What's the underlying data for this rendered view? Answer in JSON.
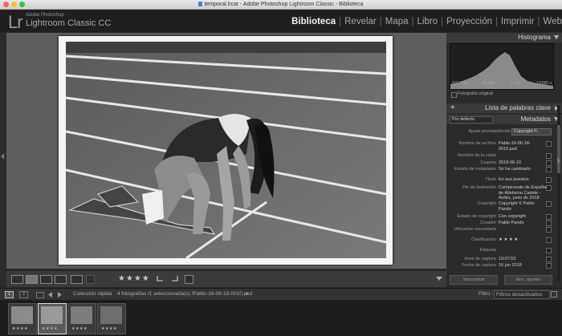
{
  "window": {
    "title": "temporal.lrcat - Adobe Photoshop Lightroom Classic - Biblioteca"
  },
  "app": {
    "logo": "Lr",
    "brand_small": "Adobe Photoshop",
    "brand_large": "Lightroom Classic CC"
  },
  "modules": [
    "Biblioteca",
    "Revelar",
    "Mapa",
    "Libro",
    "Proyección",
    "Imprimir",
    "Web"
  ],
  "active_module": "Biblioteca",
  "toolbar": {
    "rating": "★★★★"
  },
  "panels": {
    "histogram": {
      "title": "Histograma",
      "info": [
        "ISO 100",
        "50 mm",
        "f / 2,0",
        "1/1000 s"
      ],
      "original_label": "Fotografía original"
    },
    "keywords": {
      "title": "Lista de palabras clave",
      "plus": "+"
    },
    "metadata": {
      "preset": "Por defecto",
      "title": "Metadatos",
      "preset_row_label": "Ajuste preestablecido",
      "preset_row_value": "Copyright P...",
      "rows": [
        {
          "k": "Nombre de archivo",
          "v": "Pablo-16-06-18-0010.psd"
        },
        {
          "k": "Nombre de la copia",
          "v": ""
        },
        {
          "k": "Carpeta",
          "v": "2018-06-16"
        },
        {
          "k": "Estado de metadatos",
          "v": "Se ha cambiado"
        },
        {
          "k": "Título",
          "v": "En sus puestos"
        },
        {
          "k": "Pie de ilustración",
          "v": "Campeonato de España de Atletismo Cadete - Avilés, junio de 2018"
        },
        {
          "k": "Copyright",
          "v": "Copyright © Pablo Pando"
        },
        {
          "k": "Estado de copyright",
          "v": "Con copyright"
        },
        {
          "k": "Creador",
          "v": "Pablo Pando"
        },
        {
          "k": "Ubicación secundaria",
          "v": ""
        },
        {
          "k": "Clasificación",
          "v": "★ ★ ★ ★ ·"
        },
        {
          "k": "Etiqueta",
          "v": ""
        },
        {
          "k": "Hora de captura",
          "v": "19:07:53"
        },
        {
          "k": "Fecha de captura",
          "v": "16 jun 2018"
        }
      ],
      "sync_meta": "Sincronizar",
      "sync_settings": "Sinc. ajustes"
    }
  },
  "filmstrip": {
    "pages": [
      "1",
      "2"
    ],
    "source": "Colección rápida",
    "count": "4 fotografías /1 seleccionada(s) /Pablo-16-06-18-0010.psd",
    "filter_label": "Filtro :",
    "filter_value": "Filtros desactivados",
    "thumbs": [
      {
        "stars": "★★★★"
      },
      {
        "stars": "★★★★"
      },
      {
        "stars": "★★★★"
      },
      {
        "stars": "★★★★"
      }
    ]
  }
}
